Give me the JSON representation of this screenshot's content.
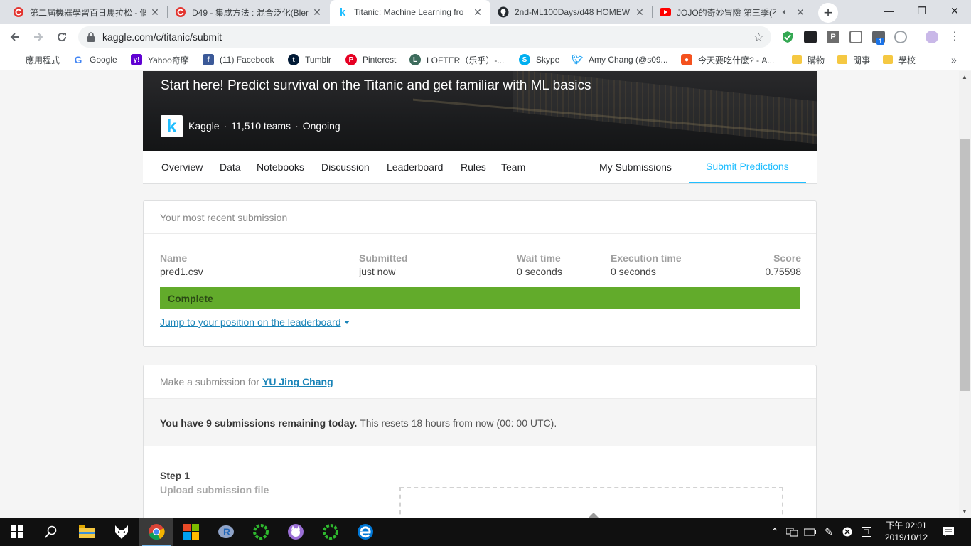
{
  "browser": {
    "tabs": [
      {
        "title": "第二屆機器學習百日馬拉松 - 個",
        "icon": "cupoy-icon"
      },
      {
        "title": "D49 - 集成方法 : 混合泛化(Blen",
        "icon": "cupoy-icon"
      },
      {
        "title": "Titanic: Machine Learning fro",
        "icon": "kaggle-icon",
        "active": true
      },
      {
        "title": "2nd-ML100Days/d48 HOMEW",
        "icon": "github-icon"
      },
      {
        "title": "JOJO的奇妙冒險 第三季(不",
        "icon": "youtube-icon"
      }
    ],
    "url": "kaggle.com/c/titanic/submit",
    "bookmarks": [
      {
        "label": "應用程式"
      },
      {
        "label": "Google"
      },
      {
        "label": "Yahoo奇摩"
      },
      {
        "label": "(11) Facebook"
      },
      {
        "label": "Tumblr"
      },
      {
        "label": "Pinterest"
      },
      {
        "label": "LOFTER（乐乎）-..."
      },
      {
        "label": "Skype"
      },
      {
        "label": "Amy Chang (@s09..."
      },
      {
        "label": "今天要吃什麼? - A..."
      },
      {
        "label": "購物"
      },
      {
        "label": "閒事"
      },
      {
        "label": "學校"
      }
    ],
    "more_bookmarks": "»",
    "extension_badge": "1"
  },
  "competition": {
    "subtitle": "Start here! Predict survival on the Titanic and get familiar with ML basics",
    "logo_letter": "k",
    "host": "Kaggle",
    "teams": "11,510 teams",
    "status": "Ongoing",
    "dot": "·"
  },
  "nav": {
    "overview": "Overview",
    "data": "Data",
    "notebooks": "Notebooks",
    "discussion": "Discussion",
    "leaderboard": "Leaderboard",
    "rules": "Rules",
    "team": "Team",
    "my_submissions": "My Submissions",
    "submit_predictions": "Submit Predictions"
  },
  "recent": {
    "header": "Your most recent submission",
    "columns": {
      "name": "Name",
      "submitted": "Submitted",
      "wait": "Wait time",
      "execution": "Execution time",
      "score": "Score"
    },
    "values": {
      "name": "pred1.csv",
      "submitted": "just now",
      "wait": "0 seconds",
      "execution": "0 seconds",
      "score": "0.75598"
    },
    "status": "Complete",
    "jump_link": "Jump to your position on the leaderboard"
  },
  "make_submission": {
    "prefix": "Make a submission for",
    "user": "YU Jing Chang",
    "quota_bold": "You have 9 submissions remaining today.",
    "quota_rest": "This resets 18 hours from now (00: 00 UTC).",
    "step_title": "Step 1",
    "step_subtitle": "Upload submission file"
  },
  "taskbar": {
    "clock_time": "下午 02:01",
    "clock_date": "2019/10/12"
  },
  "colors": {
    "kaggle_blue": "#20beff",
    "complete_green": "#62ab2b",
    "link_blue": "#1a84b8"
  }
}
